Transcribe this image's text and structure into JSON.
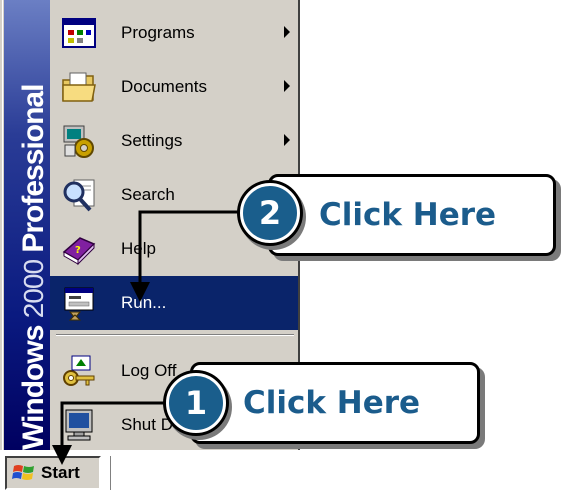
{
  "start_menu": {
    "banner": {
      "part1": "Windows",
      "part2": "2000",
      "part3": "Professional"
    },
    "items": [
      {
        "label": "Programs",
        "icon": "programs-icon",
        "submenu": true
      },
      {
        "label": "Documents",
        "icon": "documents-folder-icon",
        "submenu": true
      },
      {
        "label": "Settings",
        "icon": "settings-icon",
        "submenu": true
      },
      {
        "label": "Search",
        "icon": "search-magnifier-icon",
        "submenu": true
      },
      {
        "label": "Help",
        "icon": "help-book-icon",
        "submenu": false
      },
      {
        "label": "Run...",
        "icon": "run-icon",
        "submenu": false,
        "selected": true
      },
      {
        "label": "Log Off",
        "icon": "log-off-key-icon",
        "submenu": false
      },
      {
        "label": "Shut Down",
        "icon": "shut-down-icon",
        "submenu": false
      }
    ],
    "selection_color": "#0a246a"
  },
  "taskbar": {
    "start_label": "Start"
  },
  "callouts": [
    {
      "step": "1",
      "text": "Click Here"
    },
    {
      "step": "2",
      "text": "Click Here"
    }
  ],
  "accent_color": "#1b5c8c"
}
